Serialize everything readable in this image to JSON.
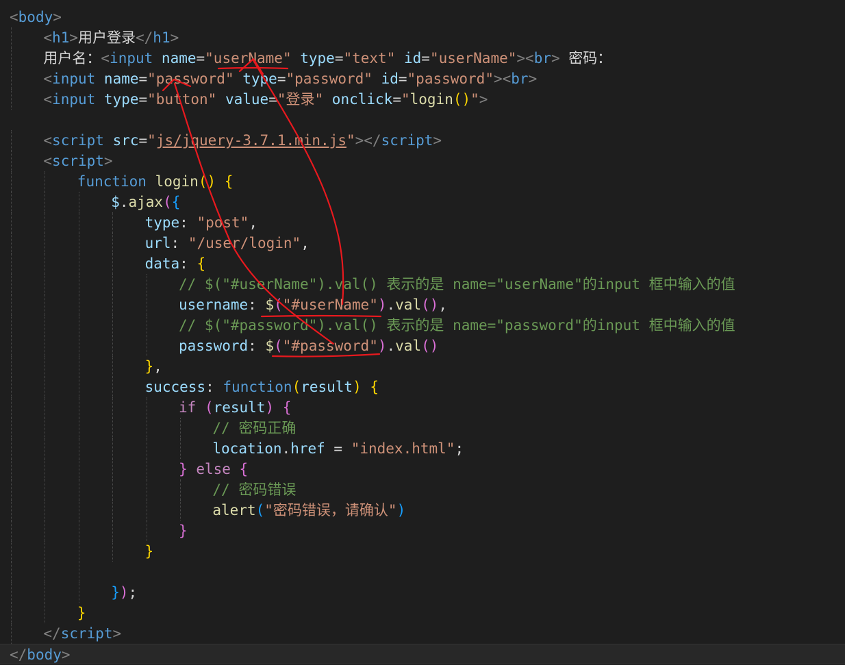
{
  "theme": {
    "background": "#1e1e1e",
    "tag_punct": "#808080",
    "tag_name": "#569cd6",
    "attribute": "#9cdcfe",
    "string": "#ce9178",
    "keyword": "#569cd6",
    "control_keyword": "#c586c0",
    "function": "#dcdcaa",
    "comment": "#6a9955",
    "text": "#d4d4d4",
    "bracket_1": "#ffd700",
    "bracket_2": "#da70d6",
    "bracket_3": "#179fff",
    "annotation": "#e8191e"
  },
  "editor": {
    "lines": [
      {
        "indent": 0,
        "tokens": [
          [
            "tagp",
            "<"
          ],
          [
            "tag",
            "body"
          ],
          [
            "tagp",
            ">"
          ]
        ]
      },
      {
        "indent": 1,
        "tokens": [
          [
            "tagp",
            "<"
          ],
          [
            "tag",
            "h1"
          ],
          [
            "tagp",
            ">"
          ],
          [
            "txt",
            "用户登录"
          ],
          [
            "tagp",
            "</"
          ],
          [
            "tag",
            "h1"
          ],
          [
            "tagp",
            ">"
          ]
        ]
      },
      {
        "indent": 1,
        "tokens": [
          [
            "txt",
            "用户名："
          ],
          [
            "tagp",
            "<"
          ],
          [
            "tag",
            "input"
          ],
          [
            "txt",
            " "
          ],
          [
            "attr",
            "name"
          ],
          [
            "txt",
            "="
          ],
          [
            "str",
            "\"userName\""
          ],
          [
            "txt",
            " "
          ],
          [
            "attr",
            "type"
          ],
          [
            "txt",
            "="
          ],
          [
            "str",
            "\"text\""
          ],
          [
            "txt",
            " "
          ],
          [
            "attr",
            "id"
          ],
          [
            "txt",
            "="
          ],
          [
            "str",
            "\"userName\""
          ],
          [
            "tagp",
            ">"
          ],
          [
            "tagp",
            "<"
          ],
          [
            "tag",
            "br"
          ],
          [
            "tagp",
            ">"
          ],
          [
            "txt",
            " 密码："
          ]
        ]
      },
      {
        "indent": 1,
        "tokens": [
          [
            "tagp",
            "<"
          ],
          [
            "tag",
            "input"
          ],
          [
            "txt",
            " "
          ],
          [
            "attr",
            "name"
          ],
          [
            "txt",
            "="
          ],
          [
            "str",
            "\"password\""
          ],
          [
            "txt",
            " "
          ],
          [
            "attr",
            "type"
          ],
          [
            "txt",
            "="
          ],
          [
            "str",
            "\"password\""
          ],
          [
            "txt",
            " "
          ],
          [
            "attr",
            "id"
          ],
          [
            "txt",
            "="
          ],
          [
            "str",
            "\"password\""
          ],
          [
            "tagp",
            ">"
          ],
          [
            "tagp",
            "<"
          ],
          [
            "tag",
            "br"
          ],
          [
            "tagp",
            ">"
          ]
        ]
      },
      {
        "indent": 1,
        "tokens": [
          [
            "tagp",
            "<"
          ],
          [
            "tag",
            "input"
          ],
          [
            "txt",
            " "
          ],
          [
            "attr",
            "type"
          ],
          [
            "txt",
            "="
          ],
          [
            "str",
            "\"button\""
          ],
          [
            "txt",
            " "
          ],
          [
            "attr",
            "value"
          ],
          [
            "txt",
            "="
          ],
          [
            "str",
            "\"登录\""
          ],
          [
            "txt",
            " "
          ],
          [
            "attr",
            "onclick"
          ],
          [
            "txt",
            "="
          ],
          [
            "str",
            "\""
          ],
          [
            "fn",
            "login"
          ],
          [
            "b1",
            "()"
          ],
          [
            "str",
            "\""
          ],
          [
            "tagp",
            ">"
          ]
        ]
      },
      {
        "indent": 0,
        "tokens": []
      },
      {
        "indent": 1,
        "tokens": [
          [
            "tagp",
            "<"
          ],
          [
            "tag",
            "script"
          ],
          [
            "txt",
            " "
          ],
          [
            "attr",
            "src"
          ],
          [
            "txt",
            "="
          ],
          [
            "str",
            "\""
          ],
          [
            "link",
            "js/jquery-3.7.1.min.js"
          ],
          [
            "str",
            "\""
          ],
          [
            "tagp",
            "></"
          ],
          [
            "tag",
            "script"
          ],
          [
            "tagp",
            ">"
          ]
        ]
      },
      {
        "indent": 1,
        "tokens": [
          [
            "tagp",
            "<"
          ],
          [
            "tag",
            "script"
          ],
          [
            "tagp",
            ">"
          ]
        ]
      },
      {
        "indent": 2,
        "tokens": [
          [
            "kw",
            "function"
          ],
          [
            "txt",
            " "
          ],
          [
            "fn",
            "login"
          ],
          [
            "b1",
            "()"
          ],
          [
            "txt",
            " "
          ],
          [
            "b1",
            "{"
          ]
        ]
      },
      {
        "indent": 3,
        "tokens": [
          [
            "var",
            "$"
          ],
          [
            "txt",
            "."
          ],
          [
            "fn",
            "ajax"
          ],
          [
            "b2",
            "("
          ],
          [
            "b3",
            "{"
          ]
        ]
      },
      {
        "indent": 4,
        "tokens": [
          [
            "prop",
            "type"
          ],
          [
            "txt",
            ": "
          ],
          [
            "str",
            "\"post\""
          ],
          [
            "txt",
            ","
          ]
        ]
      },
      {
        "indent": 4,
        "tokens": [
          [
            "prop",
            "url"
          ],
          [
            "txt",
            ": "
          ],
          [
            "str",
            "\"/user/login\""
          ],
          [
            "txt",
            ","
          ]
        ]
      },
      {
        "indent": 4,
        "tokens": [
          [
            "prop",
            "data"
          ],
          [
            "txt",
            ": "
          ],
          [
            "b1",
            "{"
          ]
        ]
      },
      {
        "indent": 5,
        "tokens": [
          [
            "cmt",
            "// $(\"#userName\").val() 表示的是 name=\"userName\"的input 框中输入的值"
          ]
        ]
      },
      {
        "indent": 5,
        "tokens": [
          [
            "prop",
            "username"
          ],
          [
            "txt",
            ": "
          ],
          [
            "fn",
            "$"
          ],
          [
            "b2",
            "("
          ],
          [
            "str",
            "\"#userName\""
          ],
          [
            "b2",
            ")"
          ],
          [
            "txt",
            "."
          ],
          [
            "fn",
            "val"
          ],
          [
            "b2",
            "()"
          ],
          [
            "txt",
            ","
          ]
        ]
      },
      {
        "indent": 5,
        "tokens": [
          [
            "cmt",
            "// $(\"#password\").val() 表示的是 name=\"password\"的input 框中输入的值"
          ]
        ]
      },
      {
        "indent": 5,
        "tokens": [
          [
            "prop",
            "password"
          ],
          [
            "txt",
            ": "
          ],
          [
            "fn",
            "$"
          ],
          [
            "b2",
            "("
          ],
          [
            "str",
            "\"#password\""
          ],
          [
            "b2",
            ")"
          ],
          [
            "txt",
            "."
          ],
          [
            "fn",
            "val"
          ],
          [
            "b2",
            "()"
          ]
        ]
      },
      {
        "indent": 4,
        "tokens": [
          [
            "b1",
            "}"
          ],
          [
            "txt",
            ","
          ]
        ]
      },
      {
        "indent": 4,
        "tokens": [
          [
            "prop",
            "success"
          ],
          [
            "txt",
            ": "
          ],
          [
            "kw",
            "function"
          ],
          [
            "b1",
            "("
          ],
          [
            "var",
            "result"
          ],
          [
            "b1",
            ")"
          ],
          [
            "txt",
            " "
          ],
          [
            "b1",
            "{"
          ]
        ]
      },
      {
        "indent": 5,
        "tokens": [
          [
            "kwc",
            "if"
          ],
          [
            "txt",
            " "
          ],
          [
            "b2",
            "("
          ],
          [
            "var",
            "result"
          ],
          [
            "b2",
            ")"
          ],
          [
            "txt",
            " "
          ],
          [
            "b2",
            "{"
          ]
        ]
      },
      {
        "indent": 6,
        "tokens": [
          [
            "cmt",
            "// 密码正确"
          ]
        ]
      },
      {
        "indent": 6,
        "tokens": [
          [
            "var",
            "location"
          ],
          [
            "txt",
            "."
          ],
          [
            "prop",
            "href"
          ],
          [
            "txt",
            " = "
          ],
          [
            "str",
            "\"index.html\""
          ],
          [
            "txt",
            ";"
          ]
        ]
      },
      {
        "indent": 5,
        "tokens": [
          [
            "b2",
            "}"
          ],
          [
            "txt",
            " "
          ],
          [
            "kwc",
            "else"
          ],
          [
            "txt",
            " "
          ],
          [
            "b2",
            "{"
          ]
        ]
      },
      {
        "indent": 6,
        "tokens": [
          [
            "cmt",
            "// 密码错误"
          ]
        ]
      },
      {
        "indent": 6,
        "tokens": [
          [
            "fn",
            "alert"
          ],
          [
            "b3",
            "("
          ],
          [
            "str",
            "\"密码错误，请确认\""
          ],
          [
            "b3",
            ")"
          ]
        ]
      },
      {
        "indent": 5,
        "tokens": [
          [
            "b2",
            "}"
          ]
        ]
      },
      {
        "indent": 4,
        "tokens": [
          [
            "b1",
            "}"
          ]
        ]
      },
      {
        "indent": 3,
        "tokens": []
      },
      {
        "indent": 3,
        "tokens": [
          [
            "b3",
            "}"
          ],
          [
            "b2",
            ")"
          ],
          [
            "txt",
            ";"
          ]
        ]
      },
      {
        "indent": 2,
        "tokens": [
          [
            "b1",
            "}"
          ]
        ]
      },
      {
        "indent": 1,
        "tokens": [
          [
            "tagp",
            "</"
          ],
          [
            "tag",
            "script"
          ],
          [
            "tagp",
            ">"
          ]
        ]
      },
      {
        "indent": 0,
        "tokens": [
          [
            "tagp",
            "</"
          ],
          [
            "tag",
            "body"
          ],
          [
            "tagp",
            ">"
          ]
        ],
        "current": true
      }
    ]
  }
}
